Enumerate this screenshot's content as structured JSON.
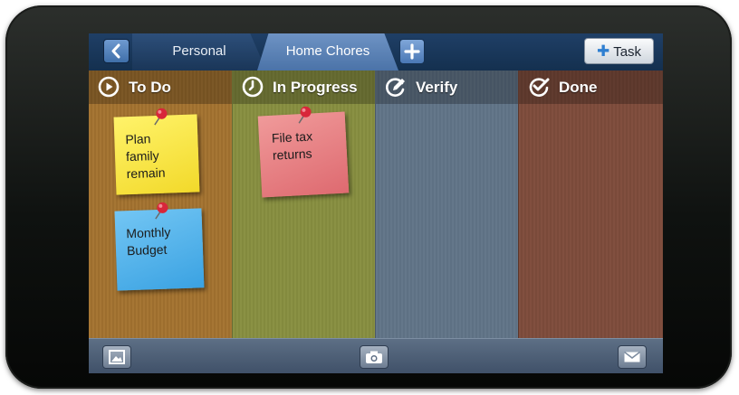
{
  "topbar": {
    "back_icon": "chevron-left-icon",
    "tabs": [
      {
        "label": "Personal",
        "selected": false
      },
      {
        "label": "Home Chores",
        "selected": true
      }
    ],
    "add_tab_icon": "plus-icon",
    "task_button_label": "Task"
  },
  "columns": [
    {
      "title": "To Do",
      "icon": "play-circle-icon",
      "color": "#a67634"
    },
    {
      "title": "In Progress",
      "icon": "clock-icon",
      "color": "#8a9144"
    },
    {
      "title": "Verify",
      "icon": "pencil-circle-icon",
      "color": "#64778a"
    },
    {
      "title": "Done",
      "icon": "check-circle-icon",
      "color": "#814f3f"
    }
  ],
  "notes": {
    "todo": [
      {
        "text": "Plan\nfamily\nremain",
        "color": "#f7e44a"
      },
      {
        "text": "Monthly\nBudget",
        "color": "#4fb1ea"
      }
    ],
    "in_progress": [
      {
        "text": "File tax\nreturns",
        "color": "#e8808a"
      }
    ]
  },
  "bottombar": {
    "buttons": [
      "photo-icon",
      "camera-icon",
      "mail-icon"
    ]
  },
  "colors": {
    "bezel": "#141614",
    "topbar": "#1a3658",
    "selected_tab": "#5f85ba",
    "bottombar": "#4d5e75",
    "pin": "#d8263a"
  }
}
